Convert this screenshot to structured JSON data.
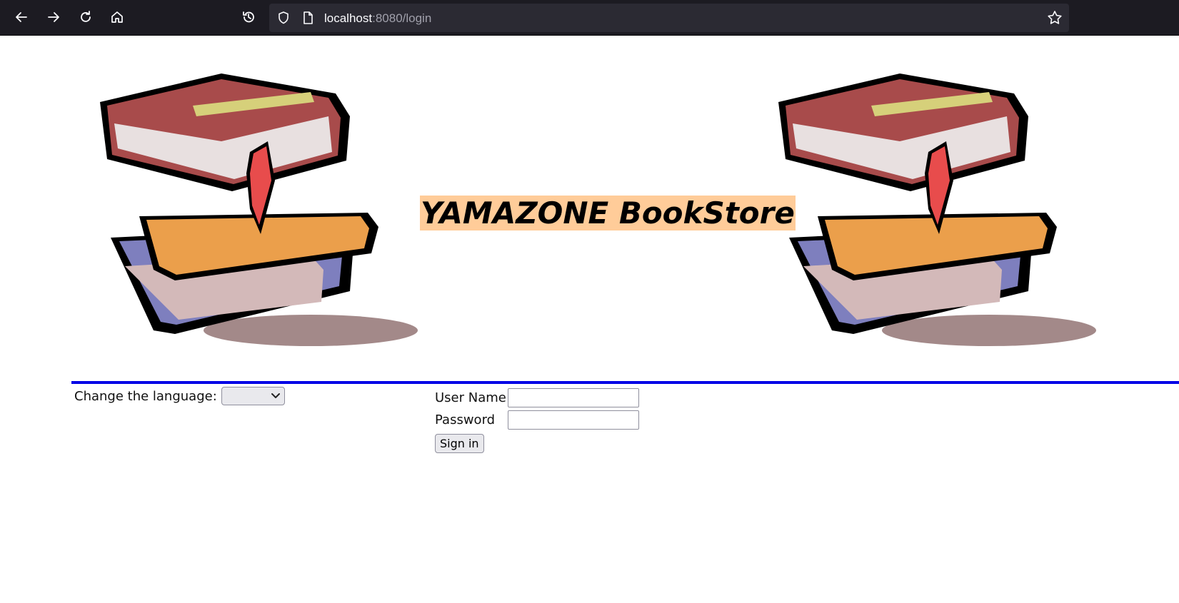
{
  "browser": {
    "url_host": "localhost",
    "url_path": ":8080/login",
    "icons": [
      "back-icon",
      "forward-icon",
      "reload-icon",
      "home-icon",
      "history-icon",
      "shield-icon",
      "page-icon",
      "star-icon"
    ]
  },
  "header": {
    "title": "YAMAZONE BookStore",
    "title_bg": "#ffcc99",
    "divider_color": "#0000e6"
  },
  "language": {
    "label": "Change the language:",
    "selected": ""
  },
  "login": {
    "username_label": "User Name",
    "username_value": "",
    "password_label": "Password",
    "password_value": "",
    "submit_label": "Sign in"
  }
}
